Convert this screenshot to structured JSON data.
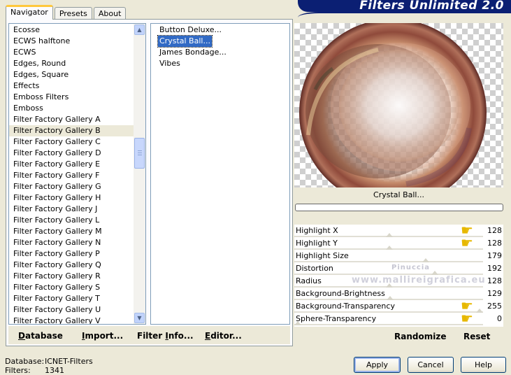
{
  "app": {
    "title": "Filters Unlimited 2.0"
  },
  "tabs": [
    "Navigator",
    "Presets",
    "About"
  ],
  "categories": {
    "items": [
      "Ecosse",
      "ECWS halftone",
      "ECWS",
      "Edges, Round",
      "Edges, Square",
      "Effects",
      "Emboss Filters",
      "Emboss",
      "Filter Factory Gallery A",
      "Filter Factory Gallery B",
      "Filter Factory Gallery C",
      "Filter Factory Gallery D",
      "Filter Factory Gallery E",
      "Filter Factory Gallery F",
      "Filter Factory Gallery G",
      "Filter Factory Gallery H",
      "Filter Factory Gallery J",
      "Filter Factory Gallery L",
      "Filter Factory Gallery M",
      "Filter Factory Gallery N",
      "Filter Factory Gallery P",
      "Filter Factory Gallery Q",
      "Filter Factory Gallery R",
      "Filter Factory Gallery S",
      "Filter Factory Gallery T",
      "Filter Factory Gallery U",
      "Filter Factory Gallery V"
    ],
    "selected": "Filter Factory Gallery B"
  },
  "filters": {
    "items": [
      "Button Deluxe...",
      "Crystal Ball...",
      "James Bondage...",
      "Vibes"
    ],
    "selected": "Crystal Ball..."
  },
  "left_buttons": {
    "database": {
      "u": "D",
      "rest": "atabase"
    },
    "import": {
      "u": "I",
      "rest": "mport..."
    },
    "filter_info": {
      "pre": "Filter ",
      "u": "I",
      "rest": "nfo..."
    },
    "editor": {
      "u": "E",
      "rest": "ditor..."
    }
  },
  "preview": {
    "filter_name": "Crystal Ball..."
  },
  "sliders": [
    {
      "label": "Highlight X",
      "value": "128",
      "level": 128,
      "pointer": true
    },
    {
      "label": "Highlight Y",
      "value": "128",
      "level": 128,
      "pointer": true
    },
    {
      "label": "Highlight Size",
      "value": "179",
      "level": 179,
      "pointer": false
    },
    {
      "label": "Distortion",
      "value": "192",
      "level": 192,
      "pointer": false
    },
    {
      "label": "Radius",
      "value": "128",
      "level": 128,
      "pointer": false
    },
    {
      "label": "Background-Brightness",
      "value": "129",
      "level": 129,
      "pointer": false
    },
    {
      "label": "Background-Transparency",
      "value": "255",
      "level": 255,
      "pointer": true
    },
    {
      "label": "Sphere-Transparency",
      "value": "0",
      "level": 0,
      "pointer": true
    }
  ],
  "watermark": {
    "line1": "Pinuccia",
    "line2": "www.mallireigrafica.eu"
  },
  "right_buttons": {
    "randomize": "Randomize",
    "reset": "Reset"
  },
  "status": {
    "database_label": "Database:",
    "database_value": "ICNET-Filters",
    "filters_label": "Filters:",
    "filters_value": "1341"
  },
  "dialog_buttons": {
    "apply": "Apply",
    "cancel": "Cancel",
    "help": "Help"
  },
  "colors": {
    "selection": "#316ac5",
    "brand": "#0b1f73",
    "pointer": "#e7b800"
  }
}
